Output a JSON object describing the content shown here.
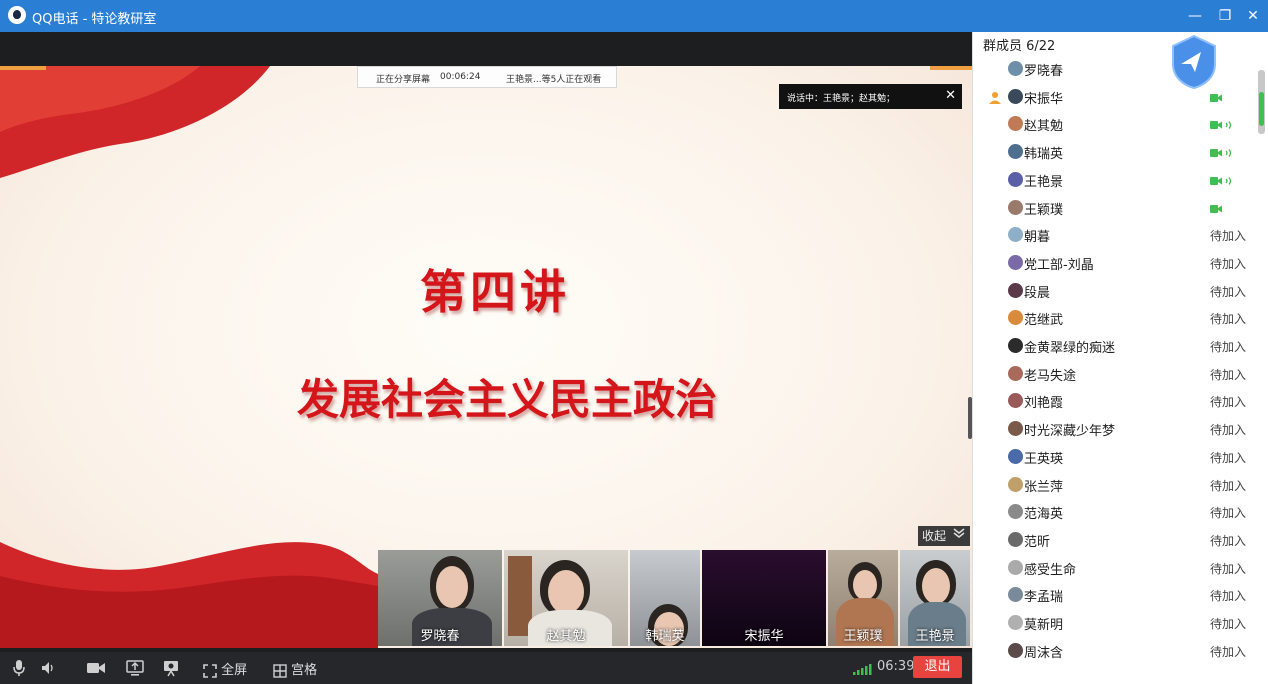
{
  "window": {
    "title": "QQ电话 - 特论教研室",
    "minimize": "—",
    "restore": "❐",
    "close": "✕"
  },
  "share_bar": {
    "status": "正在分享屏幕",
    "elapsed": "00:06:24",
    "viewers": "王艳景...等5人正在观看"
  },
  "talking": {
    "text": "说话中：王艳景；赵其勉；",
    "close": "✕"
  },
  "slide": {
    "line1": "第四讲",
    "line2": "发展社会主义民主政治"
  },
  "collapse_label": "收起",
  "thumbnails": [
    {
      "name": "罗晓春"
    },
    {
      "name": "赵其勉"
    },
    {
      "name": "韩瑞英"
    },
    {
      "name": "宋振华"
    },
    {
      "name": "王颖璞"
    },
    {
      "name": "王艳景"
    }
  ],
  "toolbar": {
    "fullscreen_label": "全屏",
    "grid_label": "宫格",
    "timer": "06:39",
    "exit_label": "退出"
  },
  "panel": {
    "header": "群成员 6/22",
    "members": [
      {
        "name": "罗晓春",
        "status": "",
        "camera": false
      },
      {
        "name": "宋振华",
        "status": "",
        "camera": true
      },
      {
        "name": "赵其勉",
        "status": "",
        "camera": true
      },
      {
        "name": "韩瑞英",
        "status": "",
        "camera": true
      },
      {
        "name": "王艳景",
        "status": "",
        "camera": true
      },
      {
        "name": "王颖璞",
        "status": "",
        "camera": true
      },
      {
        "name": "朝暮",
        "status": "待加入",
        "camera": false
      },
      {
        "name": "党工部-刘晶",
        "status": "待加入",
        "camera": false
      },
      {
        "name": "段晨",
        "status": "待加入",
        "camera": false
      },
      {
        "name": "范继武",
        "status": "待加入",
        "camera": false
      },
      {
        "name": "金黄翠绿的痴迷",
        "status": "待加入",
        "camera": false
      },
      {
        "name": "老马失途",
        "status": "待加入",
        "camera": false
      },
      {
        "name": "刘艳霞",
        "status": "待加入",
        "camera": false
      },
      {
        "name": "时光深藏少年梦",
        "status": "待加入",
        "camera": false
      },
      {
        "name": "王英瑛",
        "status": "待加入",
        "camera": false
      },
      {
        "name": "张兰萍",
        "status": "待加入",
        "camera": false
      },
      {
        "name": "范海英",
        "status": "待加入",
        "camera": false
      },
      {
        "name": "范昕",
        "status": "待加入",
        "camera": false
      },
      {
        "name": "感受生命",
        "status": "待加入",
        "camera": false
      },
      {
        "name": "李孟瑞",
        "status": "待加入",
        "camera": false
      },
      {
        "name": "莫新明",
        "status": "待加入",
        "camera": false
      },
      {
        "name": "周沫含",
        "status": "待加入",
        "camera": false
      }
    ]
  },
  "colors": {
    "title_bar": "#2a7fd5",
    "slide_red": "#d4161b",
    "exit_red": "#e8433f",
    "camera_green": "#3fbf52"
  },
  "icons": {
    "app": "qq-penguin-icon",
    "brand": "qq-shield-bird-icon",
    "mic": "microphone-icon",
    "speaker": "speaker-icon",
    "camera": "video-camera-icon",
    "share": "screen-share-icon",
    "presenter": "presenter-icon",
    "fullscreen": "fullscreen-icon",
    "grid": "grid-icon"
  }
}
